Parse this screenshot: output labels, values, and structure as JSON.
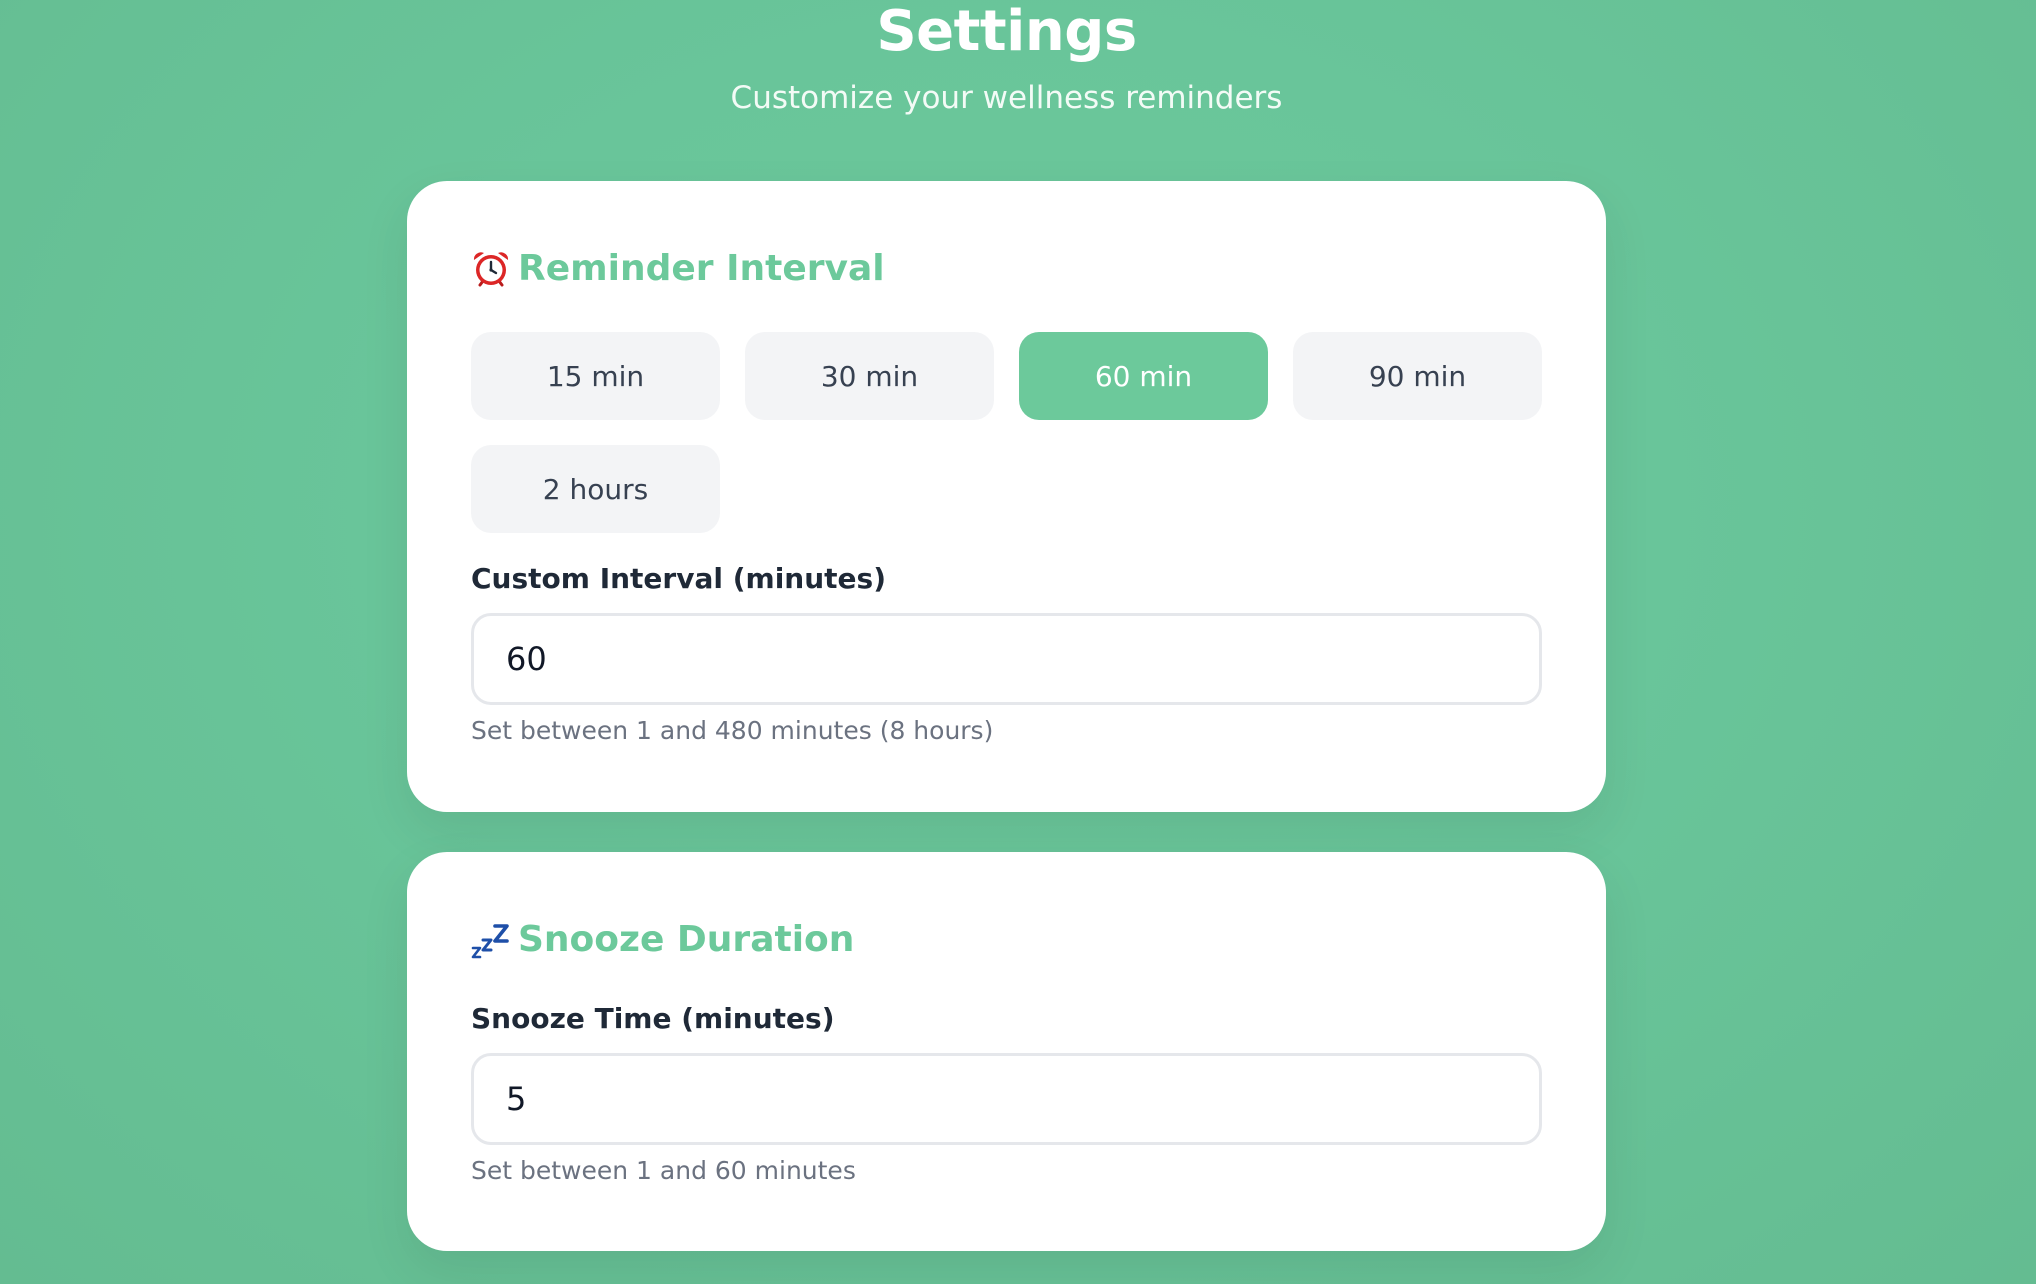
{
  "header": {
    "title": "Settings",
    "subtitle": "Customize your wellness reminders"
  },
  "reminder_interval": {
    "icon": "alarm-clock-icon",
    "title": "Reminder Interval",
    "options": [
      {
        "label": "15 min",
        "selected": false
      },
      {
        "label": "30 min",
        "selected": false
      },
      {
        "label": "60 min",
        "selected": true
      },
      {
        "label": "90 min",
        "selected": false
      },
      {
        "label": "2 hours",
        "selected": false
      }
    ],
    "custom_label": "Custom Interval (minutes)",
    "custom_value": "60",
    "help": "Set between 1 and 480 minutes (8 hours)"
  },
  "snooze": {
    "icon": "zzz-sleep-icon",
    "title": "Snooze Duration",
    "field_label": "Snooze Time (minutes)",
    "value": "5",
    "help": "Set between 1 and 60 minutes"
  },
  "colors": {
    "accent": "#6cc99b",
    "background": "#69c59a",
    "button_bg": "#f3f4f6",
    "text_dark": "#1f2937",
    "text_muted": "#6b7280"
  }
}
